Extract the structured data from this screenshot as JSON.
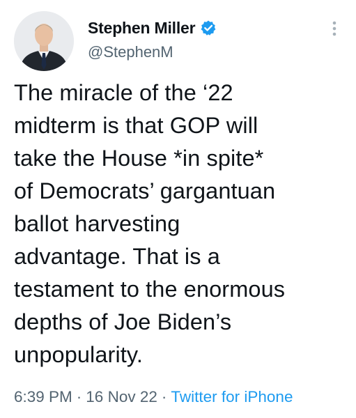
{
  "author": {
    "display_name": "Stephen Miller",
    "handle": "@StephenM",
    "verified_icon": "verified-badge-icon",
    "avatar_icon": "profile-photo"
  },
  "more_icon": "more-vertical-icon",
  "tweet": {
    "lines": [
      "The miracle of the ‘22",
      "midterm is that GOP will",
      "take the House *in spite*",
      "of Democrats’ gargantuan",
      "ballot harvesting",
      "advantage. That is a",
      "testament to the enormous",
      "depths of Joe Biden’s",
      "unpopularity."
    ]
  },
  "meta": {
    "time": "6:39 PM",
    "separator": "·",
    "date": "16 Nov 22",
    "source": "Twitter for iPhone"
  },
  "colors": {
    "text": "#0f1419",
    "secondary": "#536471",
    "link": "#1d9bf0"
  }
}
